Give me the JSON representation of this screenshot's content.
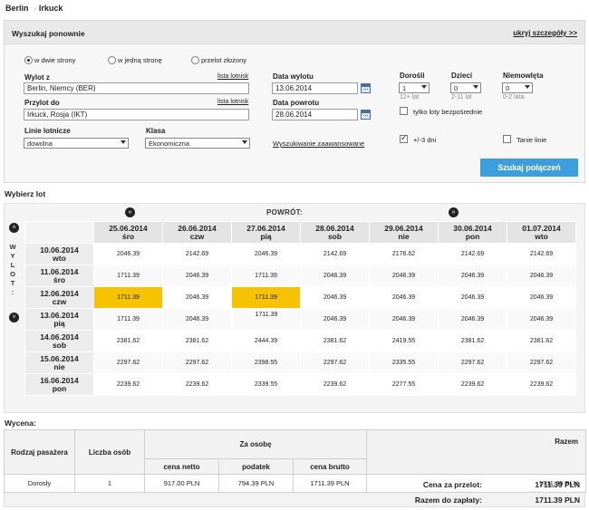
{
  "breadcrumb": {
    "from": "Berlin",
    "separator": "›",
    "to": "Irkuck"
  },
  "search": {
    "title": "Wyszukaj ponownie",
    "hide_details": "ukryj szczegóły >>",
    "trip_types": [
      "w dwie strony",
      "w jedną stronę",
      "przelot złożony"
    ],
    "trip_type_selected": 0,
    "from_label": "Wylot z",
    "from_value": "Berlin, Niemcy (BER)",
    "to_label": "Przylot do",
    "to_value": "Irkuck, Rosja (IKT)",
    "airport_list": "lista lotnisk",
    "depart_label": "Data wylotu",
    "depart_value": "13.06.2014",
    "return_label": "Data powrotu",
    "return_value": "28.06.2014",
    "adults_label": "Dorośli",
    "adults_value": "1",
    "adults_hint": "12+ lat",
    "children_label": "Dzieci",
    "children_value": "0",
    "children_hint": "2-11 lat",
    "infants_label": "Niemowlęta",
    "infants_value": "0",
    "infants_hint": "0-2 lata",
    "direct_label": "tylko loty bezpośrednie",
    "direct_checked": false,
    "airlines_label": "Linie lotnicze",
    "airlines_value": "dowolna",
    "class_label": "Klasa",
    "class_value": "Ekonomiczna",
    "advanced_link": "Wyszukiwanie zaawansowane",
    "flex_label": "+/-3 dni",
    "flex_checked": true,
    "cheap_label": "Tanie linie",
    "cheap_checked": false,
    "submit": "Szukaj połączeń"
  },
  "grid": {
    "title": "Wybierz lot",
    "return_label": "POWRÓT:",
    "outbound_label": "WYLOT:",
    "highlight_color": "#f7c200",
    "return_dates": [
      {
        "date": "25.06.2014",
        "day": "śro"
      },
      {
        "date": "26.06.2014",
        "day": "czw"
      },
      {
        "date": "27.06.2014",
        "day": "pią"
      },
      {
        "date": "28.06.2014",
        "day": "sob"
      },
      {
        "date": "29.06.2014",
        "day": "nie"
      },
      {
        "date": "30.06.2014",
        "day": "pon"
      },
      {
        "date": "01.07.2014",
        "day": "wto"
      }
    ],
    "rows": [
      {
        "date": "10.06.2014",
        "day": "wto",
        "prices": [
          "2046.39",
          "2142.69",
          "2046.39",
          "2142.69",
          "2176.62",
          "2142.69",
          "2142.69"
        ],
        "cheapest": []
      },
      {
        "date": "11.06.2014",
        "day": "śro",
        "prices": [
          "1711.39",
          "2046.39",
          "1711.39",
          "2046.39",
          "2046.39",
          "2046.39",
          "2046.39"
        ],
        "cheapest": [
          0,
          2
        ]
      },
      {
        "date": "12.06.2014",
        "day": "czw",
        "prices": [
          "1711.39",
          "2046.39",
          "1711.39",
          "2046.39",
          "2046.39",
          "2046.39",
          "2046.39"
        ],
        "cheapest": [
          0,
          2
        ]
      },
      {
        "date": "13.06.2014",
        "day": "pią",
        "prices": [
          "1711.39",
          "2046.39",
          "1711.39",
          "2046.39",
          "2046.39",
          "2046.39",
          "2046.39"
        ],
        "cheapest": [
          0
        ],
        "selected": 2
      },
      {
        "date": "14.06.2014",
        "day": "sob",
        "prices": [
          "2381.62",
          "2381.62",
          "2444.39",
          "2381.62",
          "2419.55",
          "2381.62",
          "2381.62"
        ],
        "cheapest": []
      },
      {
        "date": "15.06.2014",
        "day": "nie",
        "prices": [
          "2297.62",
          "2297.62",
          "2398.55",
          "2297.62",
          "2335.55",
          "2297.62",
          "2297.62"
        ],
        "cheapest": []
      },
      {
        "date": "16.06.2014",
        "day": "pon",
        "prices": [
          "2239.62",
          "2239.62",
          "2339.55",
          "2239.62",
          "2277.55",
          "2239.62",
          "2239.62"
        ],
        "cheapest": []
      }
    ]
  },
  "pricing": {
    "title": "Wycena:",
    "col_type": "Rodzaj pasażera",
    "col_count": "Liczba osób",
    "col_per_person": "Za osobę",
    "col_net": "cena netto",
    "col_tax": "podatek",
    "col_gross": "cena brutto",
    "col_total": "Razem",
    "row": {
      "type": "Dorosły",
      "count": "1",
      "net": "917.00 PLN",
      "tax": "794.39 PLN",
      "gross": "1711.39 PLN",
      "total": "1711.39 PLN"
    },
    "flight_price_label": "Cena za przelot:",
    "flight_price_value": "1711.39 PLN",
    "to_pay_label": "Razem do zapłaty:",
    "to_pay_value": "1711.39 PLN"
  }
}
